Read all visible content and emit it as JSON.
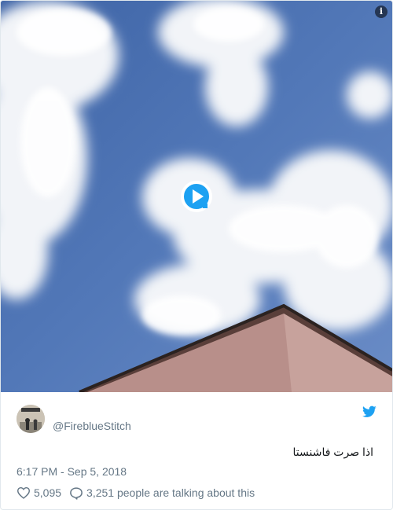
{
  "media": {
    "info_icon": "info-icon",
    "play_icon": "play-icon"
  },
  "tweet": {
    "display_name": "",
    "handle": "@FireblueStitch",
    "text": "اذا صرت فاشنستا",
    "timestamp": "6:17 PM - Sep 5, 2018",
    "likes": "5,095",
    "talking": "3,251 people are talking about this"
  },
  "colors": {
    "brand": "#1da1f2",
    "muted": "#657786",
    "text": "#14171a",
    "border": "#e1e8ed"
  },
  "icons": {
    "brand": "twitter-bird-icon",
    "like": "heart-icon",
    "reply": "speech-bubble-icon"
  }
}
